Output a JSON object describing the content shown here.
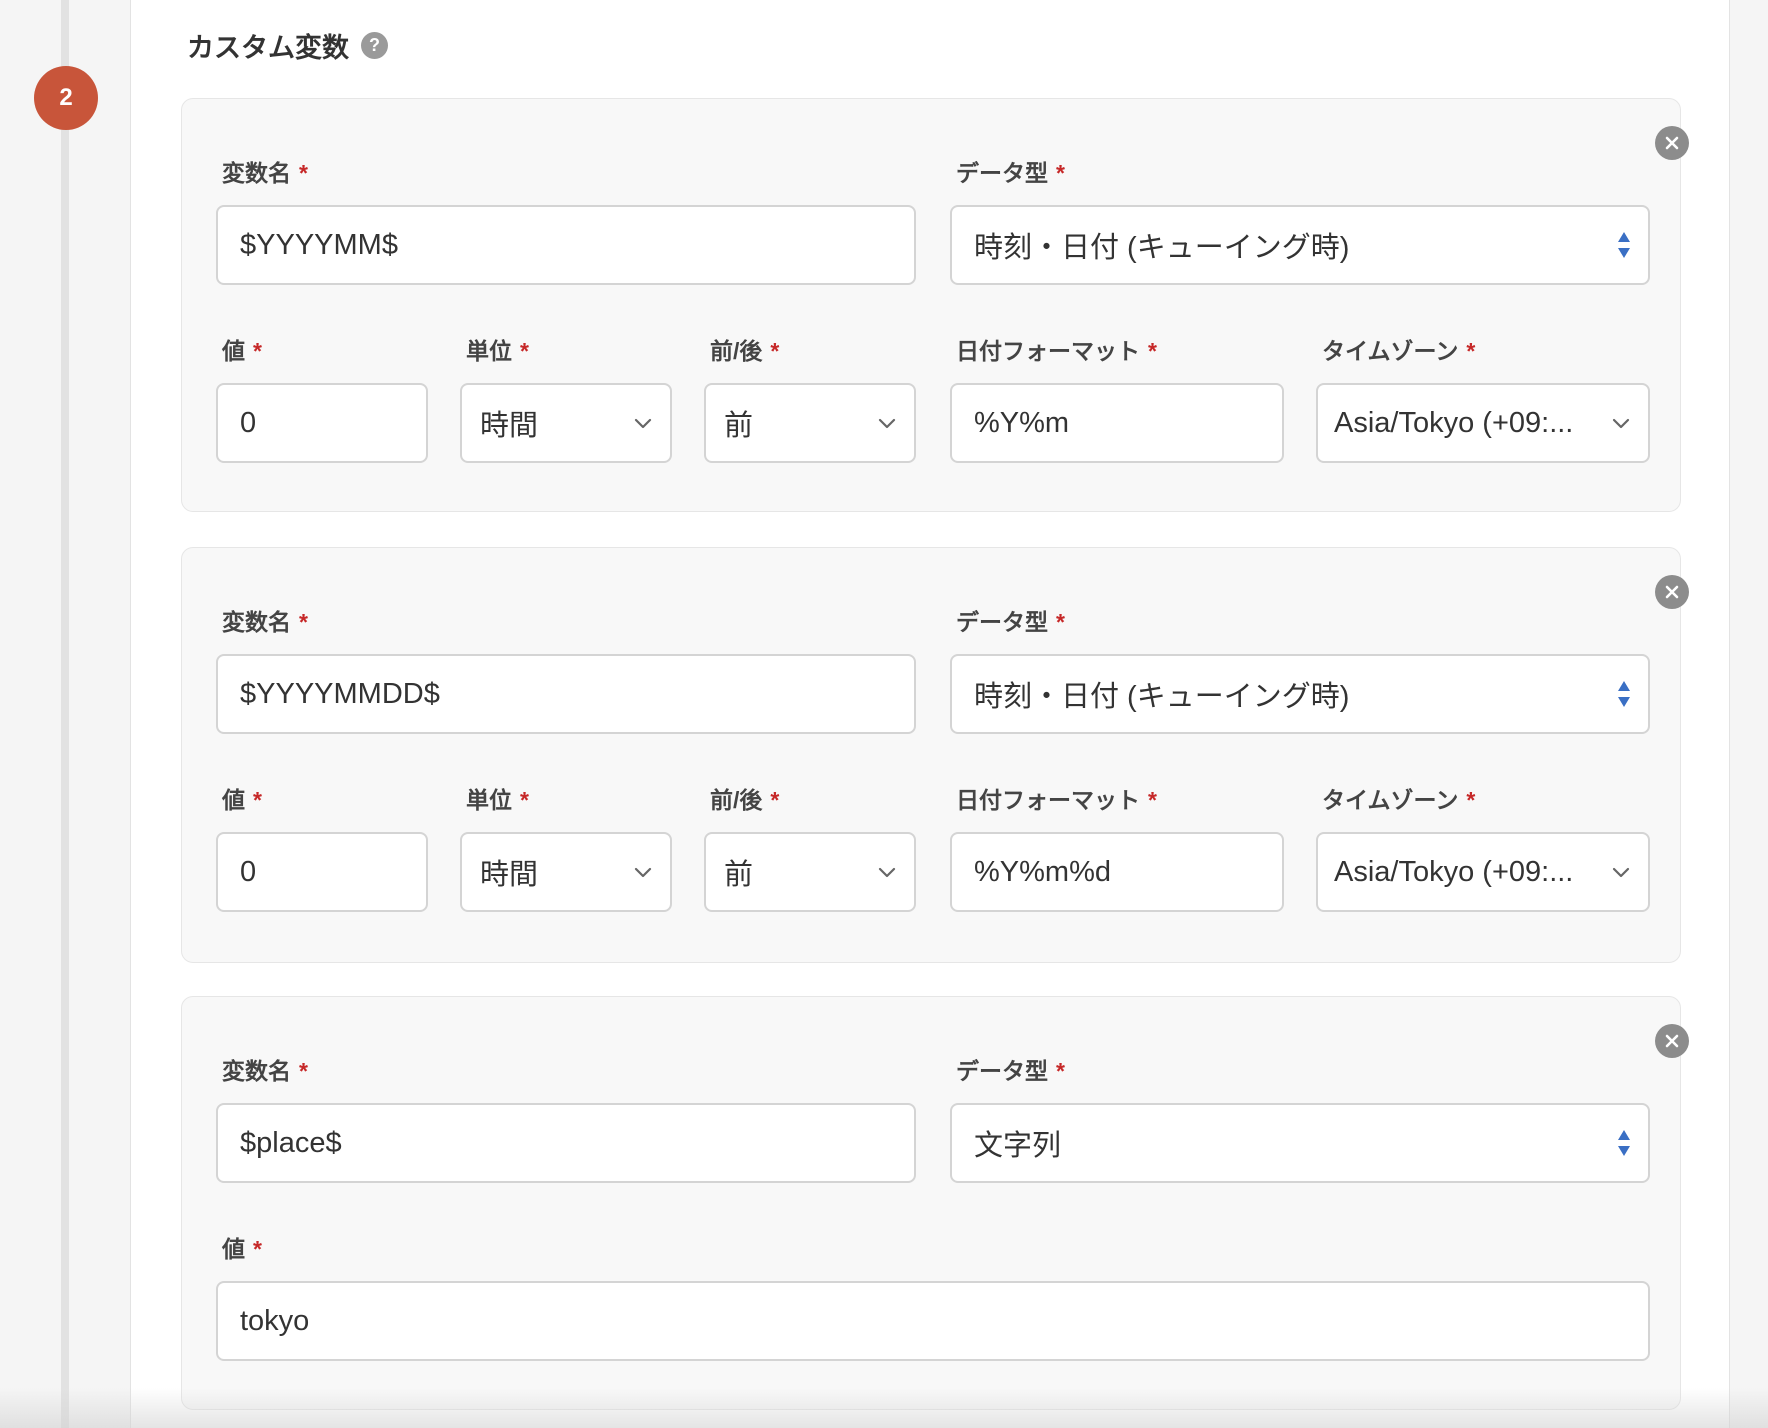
{
  "step_number": "2",
  "section": {
    "title": "カスタム変数",
    "help_icon": "?"
  },
  "required_mark": "*",
  "cards": [
    {
      "variable_name_label": "変数名",
      "variable_name_value": "$YYYYMM$",
      "data_type_label": "データ型",
      "data_type_value": "時刻・日付 (キューイング時)",
      "value_label": "値",
      "value_value": "0",
      "unit_label": "単位",
      "unit_value": "時間",
      "before_after_label": "前/後",
      "before_after_value": "前",
      "date_format_label": "日付フォーマット",
      "date_format_value": "%Y%m",
      "timezone_label": "タイムゾーン",
      "timezone_value": "Asia/Tokyo (+09:..."
    },
    {
      "variable_name_label": "変数名",
      "variable_name_value": "$YYYYMMDD$",
      "data_type_label": "データ型",
      "data_type_value": "時刻・日付 (キューイング時)",
      "value_label": "値",
      "value_value": "0",
      "unit_label": "単位",
      "unit_value": "時間",
      "before_after_label": "前/後",
      "before_after_value": "前",
      "date_format_label": "日付フォーマット",
      "date_format_value": "%Y%m%d",
      "timezone_label": "タイムゾーン",
      "timezone_value": "Asia/Tokyo (+09:..."
    },
    {
      "variable_name_label": "変数名",
      "variable_name_value": "$place$",
      "data_type_label": "データ型",
      "data_type_value": "文字列",
      "value_label": "値",
      "value_value": "tokyo"
    }
  ],
  "colors": {
    "step_badge": "#c8553a",
    "required": "#c62828",
    "updown_arrows": "#3a6fc4",
    "close_icon_bg": "#8c8c8c"
  },
  "icons": {
    "help": "question-circle-icon",
    "close": "close-circle-icon",
    "select": "chevron-down-icon",
    "native_select": "up-down-arrows-icon"
  }
}
